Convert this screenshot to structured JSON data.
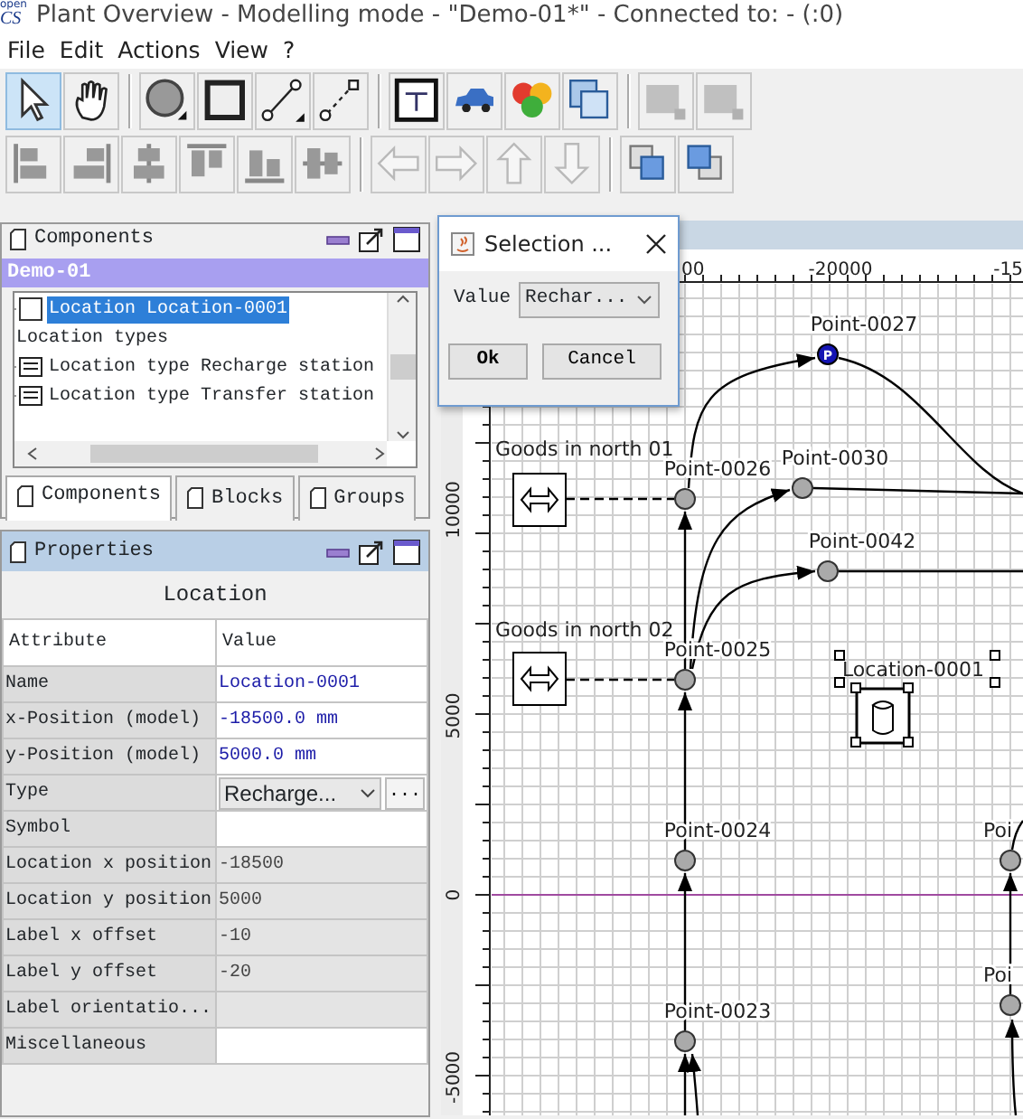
{
  "window": {
    "logo_top": "open",
    "logo_bottom": "CS",
    "title": "Plant Overview - Modelling mode - \"Demo-01*\" - Connected to: - (:0)"
  },
  "menu": [
    "File",
    "Edit",
    "Actions",
    "View",
    "?"
  ],
  "toolbar_rows": [
    [
      {
        "kind": "select",
        "selected": true,
        "disabled": false
      },
      {
        "kind": "hand",
        "selected": false,
        "disabled": false
      },
      {
        "kind": "separator"
      },
      {
        "kind": "point",
        "selected": false,
        "disabled": false
      },
      {
        "kind": "location",
        "selected": false,
        "disabled": false
      },
      {
        "kind": "path",
        "selected": false,
        "disabled": false
      },
      {
        "kind": "path-dashed",
        "selected": false,
        "disabled": false
      },
      {
        "kind": "separator"
      },
      {
        "kind": "type",
        "selected": false,
        "disabled": false
      },
      {
        "kind": "vehicle",
        "selected": false,
        "disabled": false
      },
      {
        "kind": "blocks",
        "selected": false,
        "disabled": false
      },
      {
        "kind": "groups",
        "selected": false,
        "disabled": false
      },
      {
        "kind": "separator"
      },
      {
        "kind": "layout",
        "selected": false,
        "disabled": true
      },
      {
        "kind": "layout",
        "selected": false,
        "disabled": true
      }
    ],
    [
      {
        "kind": "align-left",
        "selected": false,
        "disabled": false
      },
      {
        "kind": "align-right",
        "selected": false,
        "disabled": false
      },
      {
        "kind": "align-center",
        "selected": false,
        "disabled": false
      },
      {
        "kind": "align-top",
        "selected": false,
        "disabled": false
      },
      {
        "kind": "align-bottom",
        "selected": false,
        "disabled": false
      },
      {
        "kind": "align-middle",
        "selected": false,
        "disabled": false
      },
      {
        "kind": "separator"
      },
      {
        "kind": "left",
        "selected": false,
        "disabled": true
      },
      {
        "kind": "right",
        "selected": false,
        "disabled": true
      },
      {
        "kind": "up",
        "selected": false,
        "disabled": true
      },
      {
        "kind": "down",
        "selected": false,
        "disabled": true
      },
      {
        "kind": "separator"
      },
      {
        "kind": "front",
        "selected": false,
        "disabled": false
      },
      {
        "kind": "back",
        "selected": false,
        "disabled": false
      }
    ]
  ],
  "components": {
    "title": "Components",
    "root": "Demo-01",
    "items": [
      {
        "kind": "location",
        "label": "Location Location-0001",
        "selected": true
      },
      {
        "kind": "folder",
        "label": "Location types",
        "selected": false
      },
      {
        "kind": "type",
        "label": "Location type Recharge station",
        "selected": false
      },
      {
        "kind": "type",
        "label": "Location type Transfer station",
        "selected": false
      }
    ],
    "tabs": [
      {
        "label": "Components",
        "selected": true
      },
      {
        "label": "Blocks",
        "selected": false
      },
      {
        "label": "Groups",
        "selected": false
      }
    ]
  },
  "properties": {
    "title": "Properties",
    "subject": "Location",
    "columns": [
      "Attribute",
      "Value"
    ],
    "rows": [
      {
        "attribute": "Name",
        "kind": "model",
        "value": "Location-0001"
      },
      {
        "attribute": "x-Position (model)",
        "kind": "model",
        "value": "-18500.0 mm"
      },
      {
        "attribute": "y-Position (model)",
        "kind": "model",
        "value": "5000.0 mm"
      },
      {
        "attribute": "Type",
        "kind": "dropdown",
        "value": "Recharge...",
        "button": "..."
      },
      {
        "attribute": "Symbol",
        "kind": "editable"
      },
      {
        "attribute": "Location x position",
        "kind": "readonly",
        "value": "-18500"
      },
      {
        "attribute": "Location y position",
        "kind": "readonly",
        "value": "5000"
      },
      {
        "attribute": "Label x offset",
        "kind": "readonly",
        "value": "-10"
      },
      {
        "attribute": "Label y offset",
        "kind": "readonly",
        "value": "-20"
      },
      {
        "attribute": "Label orientatio...",
        "kind": "readonly"
      },
      {
        "attribute": "Miscellaneous",
        "kind": "editable"
      }
    ]
  },
  "dialog": {
    "title": "Selection ...",
    "label": "Value",
    "value": "Rechar...",
    "buttons": [
      {
        "label": "Ok",
        "default": true
      },
      {
        "label": "Cancel",
        "default": false
      }
    ]
  },
  "drawing": {
    "top_ruler": [
      "00",
      "-20000",
      "-15"
    ],
    "left_ruler": [
      "10000",
      "5000",
      "0",
      "-5000"
    ],
    "points": [
      {
        "label": "Point-0027",
        "kind": "park",
        "marker": "P"
      },
      {
        "label": "Point-0026",
        "kind": "halt"
      },
      {
        "label": "Point-0030",
        "kind": "halt"
      },
      {
        "label": "Point-0042",
        "kind": "halt"
      },
      {
        "label": "Point-0025",
        "kind": "halt"
      },
      {
        "label": "Point-0024",
        "kind": "halt"
      },
      {
        "label": "Point-0023",
        "kind": "halt"
      },
      {
        "label": "Poi",
        "kind": "halt"
      },
      {
        "label": "Poi",
        "kind": "halt"
      }
    ],
    "stations": [
      {
        "label": "Goods in north 01"
      },
      {
        "label": "Goods in north 02"
      }
    ],
    "locations": [
      {
        "label": "Location-0001",
        "selected": true
      }
    ]
  }
}
